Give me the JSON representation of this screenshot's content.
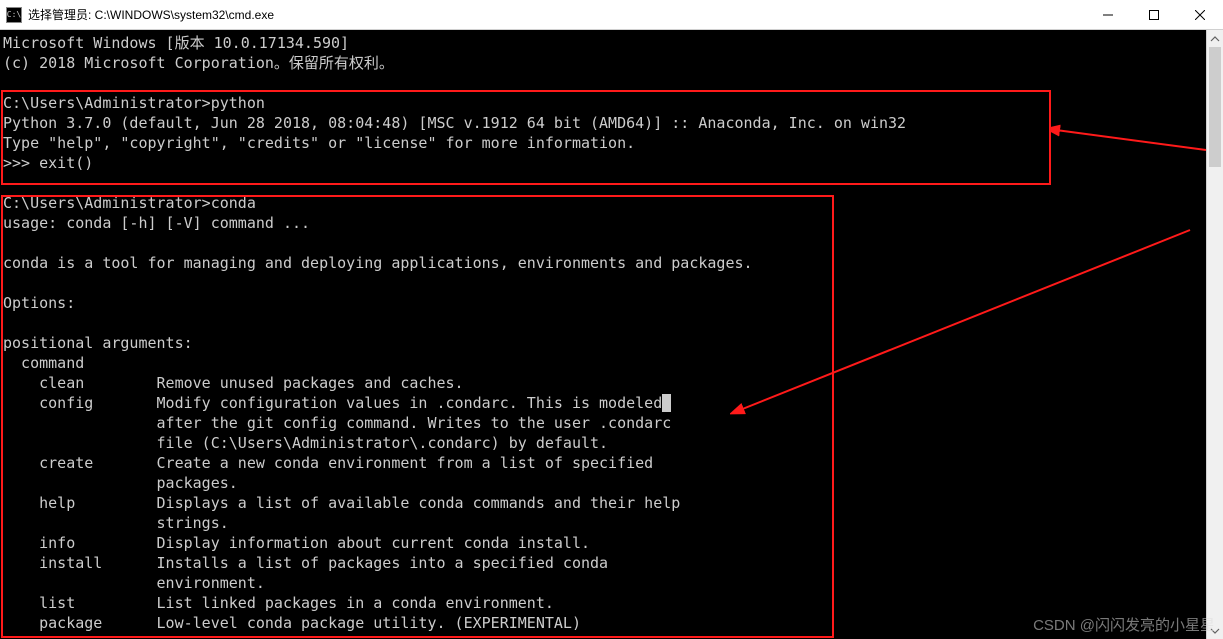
{
  "window": {
    "icon_text": "C:\\",
    "title": "选择管理员: C:\\WINDOWS\\system32\\cmd.exe"
  },
  "terminal": {
    "line1": "Microsoft Windows [版本 10.0.17134.590]",
    "line2": "(c) 2018 Microsoft Corporation。保留所有权利。",
    "blank1": "",
    "prompt1": "C:\\Users\\Administrator>python",
    "py_ver": "Python 3.7.0 (default, Jun 28 2018, 08:04:48) [MSC v.1912 64 bit (AMD64)] :: Anaconda, Inc. on win32",
    "py_help": "Type \"help\", \"copyright\", \"credits\" or \"license\" for more information.",
    "py_exit": ">>> exit()",
    "blank2": "",
    "prompt2": "C:\\Users\\Administrator>conda",
    "usage": "usage: conda [-h] [-V] command ...",
    "blank3": "",
    "conda_desc": "conda is a tool for managing and deploying applications, environments and packages.",
    "blank4": "",
    "options_hdr": "Options:",
    "blank5": "",
    "posargs_hdr": "positional arguments:",
    "cmd_hdr": "  command",
    "clean": "    clean        Remove unused packages and caches.",
    "config1": "    config       Modify configuration values in .condarc. This is modeled",
    "config2": "                 after the git config command. Writes to the user .condarc",
    "config3": "                 file (C:\\Users\\Administrator\\.condarc) by default.",
    "create1": "    create       Create a new conda environment from a list of specified",
    "create2": "                 packages.",
    "help1": "    help         Displays a list of available conda commands and their help",
    "help2": "                 strings.",
    "info": "    info         Display information about current conda install.",
    "install1": "    install      Installs a list of packages into a specified conda",
    "install2": "                 environment.",
    "list": "    list         List linked packages in a conda environment.",
    "package": "    package      Low-level conda package utility. (EXPERIMENTAL)"
  },
  "watermark": "CSDN @闪闪发亮的小星星"
}
